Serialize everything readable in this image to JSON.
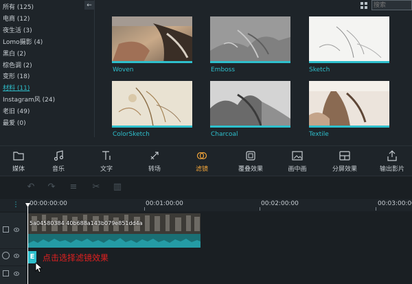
{
  "sidebar": {
    "categories": [
      {
        "label": "所有 (125)"
      },
      {
        "label": "电商 (12)"
      },
      {
        "label": "夜生活 (3)"
      },
      {
        "label": "Lomo摄影 (4)"
      },
      {
        "label": "黑白 (2)"
      },
      {
        "label": "棕色调 (2)"
      },
      {
        "label": "变形 (18)"
      },
      {
        "label": "材料 (11)"
      },
      {
        "label": "Instagram风 (24)"
      },
      {
        "label": "老旧 (49)"
      },
      {
        "label": "最爱 (0)"
      }
    ],
    "collapse_icon": "←"
  },
  "search": {
    "placeholder": "搜索"
  },
  "effects": [
    {
      "label": "Woven"
    },
    {
      "label": "Emboss"
    },
    {
      "label": "Sketch"
    },
    {
      "label": "ColorSketch"
    },
    {
      "label": "Charcoal"
    },
    {
      "label": "Textile"
    }
  ],
  "toolbar": {
    "items": [
      {
        "label": "媒体",
        "icon": "folder-icon"
      },
      {
        "label": "音乐",
        "icon": "music-icon"
      },
      {
        "label": "文字",
        "icon": "text-icon"
      },
      {
        "label": "转场",
        "icon": "transition-icon"
      },
      {
        "label": "滤镜",
        "icon": "filter-icon"
      },
      {
        "label": "覆叠效果",
        "icon": "overlay-icon"
      },
      {
        "label": "画中画",
        "icon": "pip-icon"
      },
      {
        "label": "分屏效果",
        "icon": "split-screen-icon"
      },
      {
        "label": "输出影片",
        "icon": "export-icon"
      }
    ],
    "active_color": "#f0a43a"
  },
  "timeline": {
    "ruler": [
      "00:00:00:00",
      "00:01:00:00",
      "00:02:00:00",
      "00:03:00:00"
    ],
    "clip_name": "5a04580384 40b688a143b079e851dd4a",
    "filter_clip_label": "E",
    "annotation": "点击选择滤镜效果"
  },
  "colors": {
    "accent": "#2ec0cd",
    "annotation": "#e02020"
  }
}
